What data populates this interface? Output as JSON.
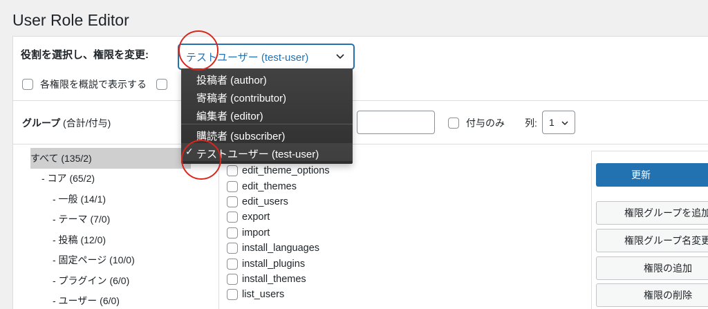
{
  "page_title": "User Role Editor",
  "role_selector": {
    "label": "役割を選択し、権限を変更:",
    "selected": "テストユーザー (test-user)",
    "options": [
      "投稿者 (author)",
      "寄稿者 (contributor)",
      "編集者 (editor)",
      "購読者 (subscriber)",
      "テストユーザー (test-user)"
    ],
    "checked_mark": "✓"
  },
  "options_row": {
    "show_human_readable": "各権限を概説で表示する"
  },
  "groups": {
    "title_bold": "グループ",
    "title_suffix": " (合計/付与)",
    "items": [
      "すべて (135/2)",
      "- コア (65/2)",
      "- 一般 (14/1)",
      "- テーマ (7/0)",
      "- 投稿 (12/0)",
      "- 固定ページ (10/0)",
      "- プラグイン (6/0)",
      "- ユーザー (6/0)"
    ]
  },
  "filters": {
    "only_granted": "付与のみ",
    "columns_label": "列:",
    "columns_value": "1"
  },
  "capabilities": [
    "edit_theme_options",
    "edit_themes",
    "edit_users",
    "export",
    "import",
    "install_languages",
    "install_plugins",
    "install_themes",
    "list_users"
  ],
  "actions": {
    "update": "更新",
    "add_group": "権限グループを追加",
    "rename_group": "権限グループ名変更",
    "add_capability": "権限の追加",
    "delete_capability": "権限の削除"
  },
  "colors": {
    "accent": "#2271b1",
    "annotation": "#d9261c"
  }
}
